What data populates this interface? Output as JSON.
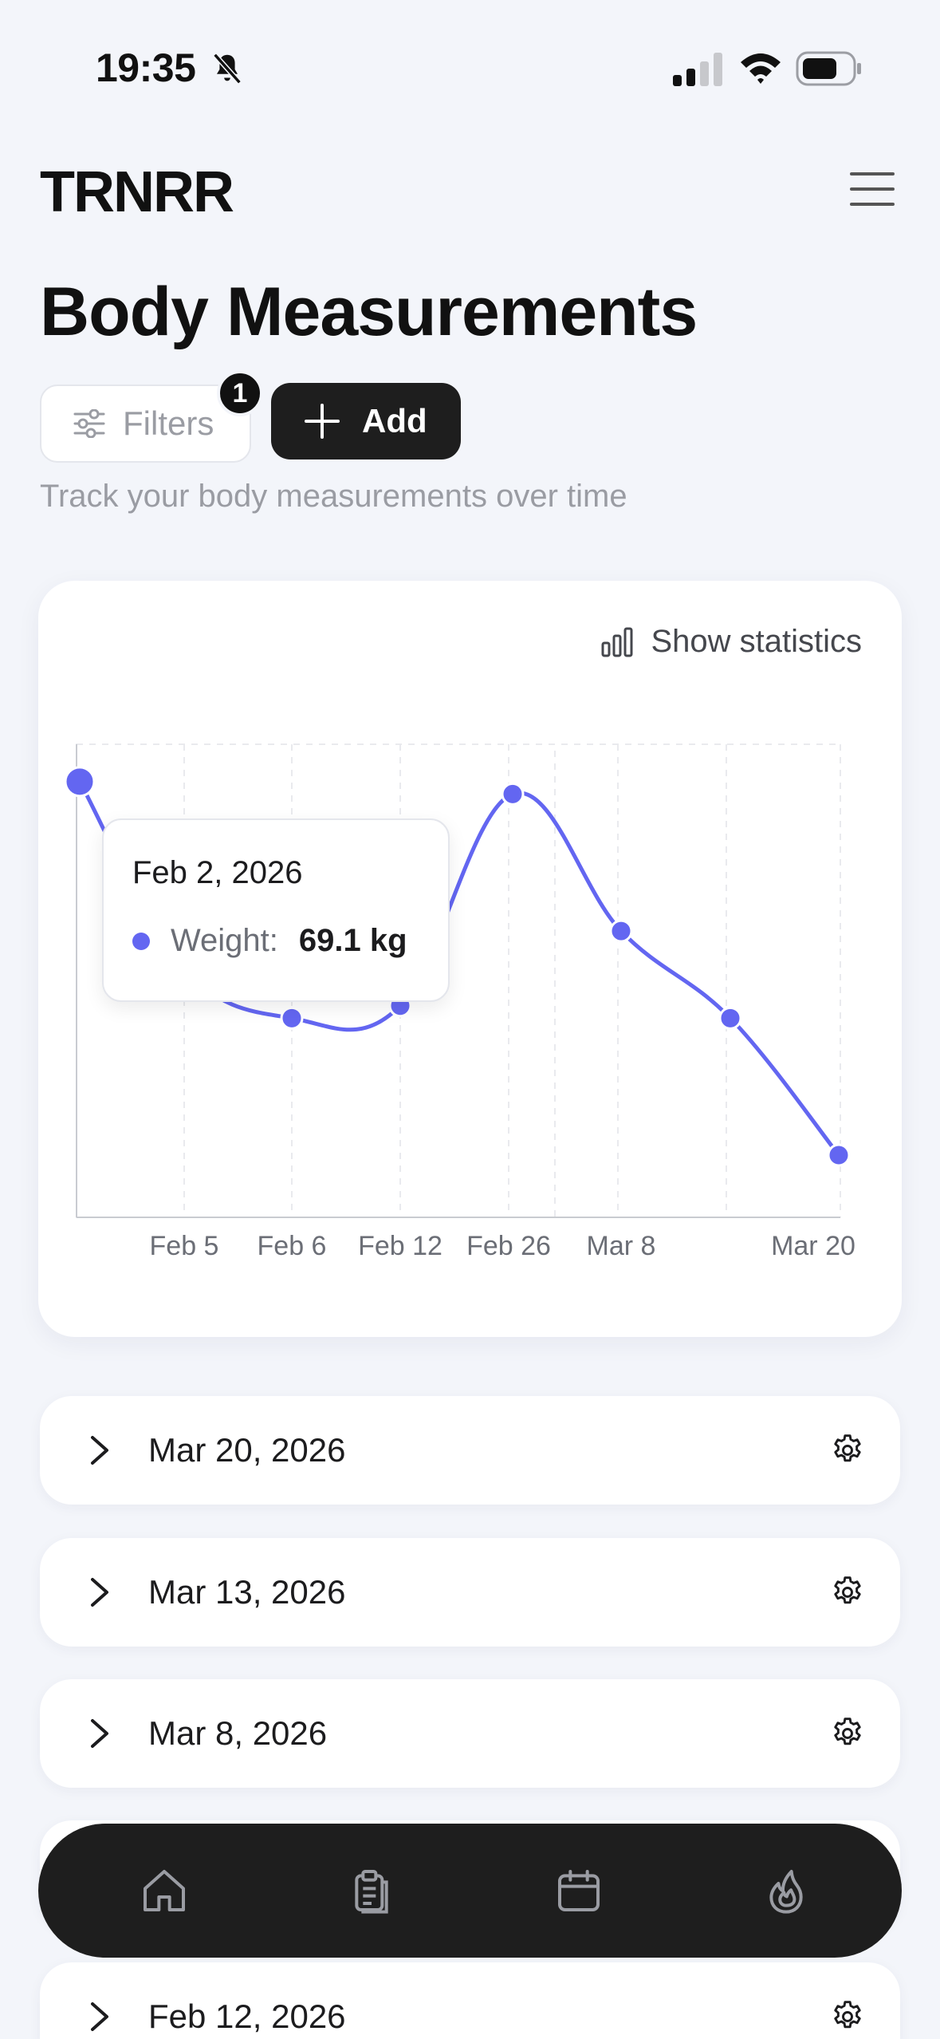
{
  "status_bar": {
    "time": "19:35",
    "icons": [
      "bell-slash-icon",
      "signal-icon",
      "wifi-icon",
      "battery-icon"
    ]
  },
  "header": {
    "logo": "TRNRR",
    "menu_icon": "hamburger-menu-icon"
  },
  "page": {
    "title": "Body Measurements",
    "filters_label": "Filters",
    "filters_badge": "1",
    "add_label": "Add",
    "subtitle": "Track your body measurements over time"
  },
  "chart_card": {
    "stats_label": "Show statistics",
    "tooltip": {
      "date": "Feb 2, 2026",
      "label": "Weight:",
      "value": "69.1 kg"
    }
  },
  "chart_data": {
    "type": "line",
    "series": [
      {
        "name": "Weight",
        "color": "#6366f1",
        "points": [
          {
            "x": "Feb 2",
            "y": 69.1
          },
          {
            "x": "Feb 5",
            "y": 67.6
          },
          {
            "x": "Feb 6",
            "y": 67.2
          },
          {
            "x": "Feb 12",
            "y": 67.3
          },
          {
            "x": "Feb 26",
            "y": 69.0
          },
          {
            "x": "Mar 8",
            "y": 67.9
          },
          {
            "x": "Mar 13",
            "y": 67.2
          },
          {
            "x": "Mar 20",
            "y": 66.1
          }
        ]
      }
    ],
    "x_tick_labels": [
      "Feb 5",
      "Feb 6",
      "Feb 12",
      "Feb 26",
      "Mar 8",
      "Mar 20"
    ],
    "ylim": [
      65.6,
      69.4
    ],
    "grid": true,
    "title": "",
    "xlabel": "",
    "ylabel": ""
  },
  "entries": [
    {
      "date": "Mar 20, 2026"
    },
    {
      "date": "Mar 13, 2026"
    },
    {
      "date": "Mar 8, 2026"
    },
    {
      "date": ""
    },
    {
      "date": "Feb 12, 2026"
    }
  ],
  "bottom_nav": {
    "items": [
      {
        "icon": "home-icon"
      },
      {
        "icon": "clipboard-icon"
      },
      {
        "icon": "calendar-icon"
      },
      {
        "icon": "flame-icon"
      }
    ]
  },
  "colors": {
    "accent": "#6366f1",
    "background": "#f3f5fa",
    "dark": "#1e1e1e"
  }
}
